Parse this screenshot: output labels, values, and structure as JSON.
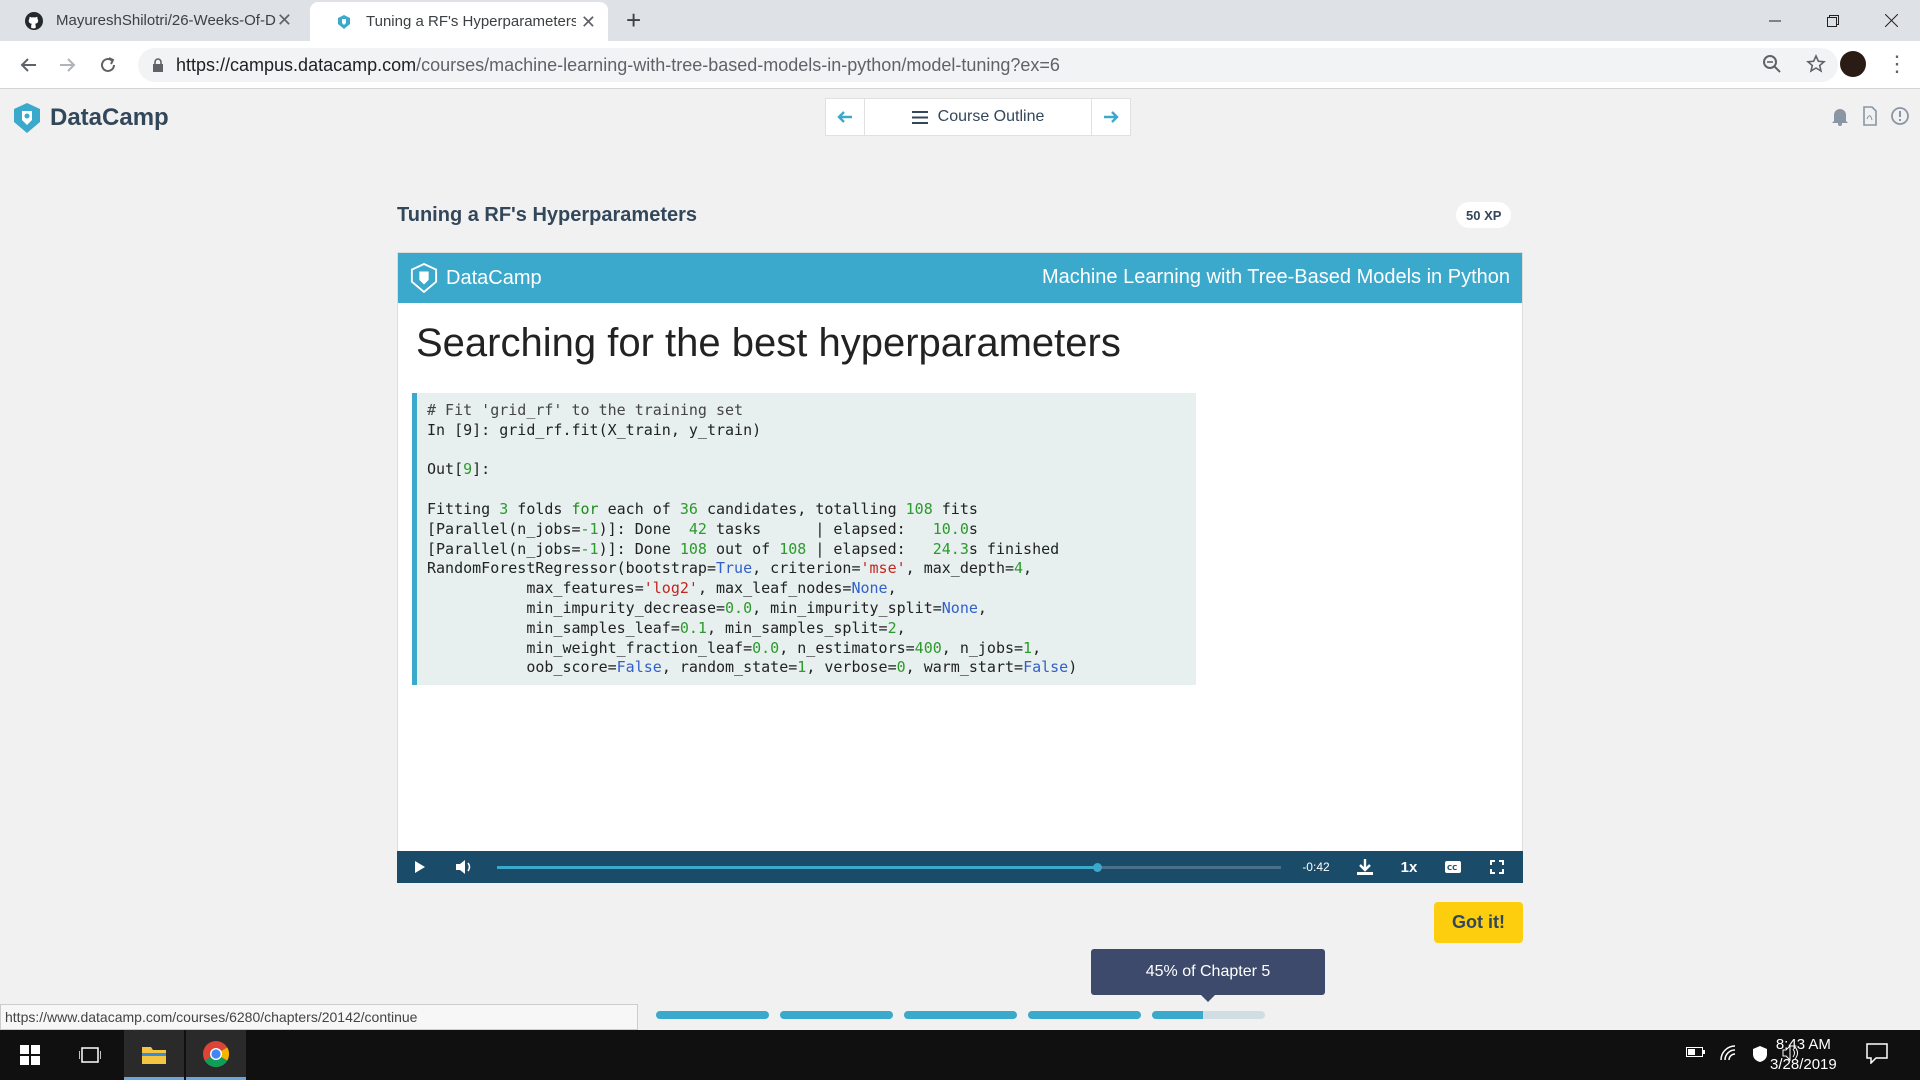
{
  "browser": {
    "tabs": [
      {
        "title": "MayureshShilotri/26-Weeks-Of-D",
        "close": "✕"
      },
      {
        "title": "Tuning a RF's Hyperparameters |",
        "close": "✕"
      }
    ],
    "new_tab": "+",
    "url_host": "https://campus.datacamp.com",
    "url_path": "/courses/machine-learning-with-tree-based-models-in-python/model-tuning?ex=6"
  },
  "header": {
    "brand": "DataCamp",
    "course_outline": "Course Outline"
  },
  "exercise": {
    "title": "Tuning a RF's Hyperparameters",
    "xp": "50 XP"
  },
  "slide": {
    "brand": "DataCamp",
    "course": "Machine Learning with Tree-Based Models in Python",
    "heading": "Searching for the best hyperparameters"
  },
  "code": {
    "l1": "# Fit 'grid_rf' to the training set",
    "l2_prompt": "In [9]: ",
    "l2_code": "grid_rf.fit(X_train, y_train)",
    "out_label": "Out[",
    "out_num": "9",
    "out_end": "]:",
    "fit_a": "Fitting ",
    "fit_n1": "3",
    "fit_b": " folds ",
    "fit_kw": "for",
    "fit_c": " each of ",
    "fit_n2": "36",
    "fit_d": " candidates, totalling ",
    "fit_n3": "108",
    "fit_e": " fits",
    "p1_a": "[Parallel(n_jobs=",
    "p1_n": "-1",
    "p1_b": ")]: Done  ",
    "p1_n2": "42",
    "p1_c": " tasks      | elapsed:   ",
    "p1_n3": "10.0",
    "p1_d": "s",
    "p2_a": "[Parallel(n_jobs=",
    "p2_n": "-1",
    "p2_b": ")]: Done ",
    "p2_n2": "108",
    "p2_c": " out of ",
    "p2_n3": "108",
    "p2_d": " | elapsed:   ",
    "p2_n4": "24.3",
    "p2_e": "s finished",
    "r1_a": "RandomForestRegressor(bootstrap=",
    "r1_t": "True",
    "r1_b": ", criterion=",
    "r1_s": "'mse'",
    "r1_c": ", max_depth=",
    "r1_n": "4",
    "r1_d": ",",
    "r2_a": "           max_features=",
    "r2_s": "'log2'",
    "r2_b": ", max_leaf_nodes=",
    "r2_t": "None",
    "r2_c": ",",
    "r3_a": "           min_impurity_decrease=",
    "r3_n": "0.0",
    "r3_b": ", min_impurity_split=",
    "r3_t": "None",
    "r3_c": ",",
    "r4_a": "           min_samples_leaf=",
    "r4_n": "0.1",
    "r4_b": ", min_samples_split=",
    "r4_n2": "2",
    "r4_c": ",",
    "r5_a": "           min_weight_fraction_leaf=",
    "r5_n": "0.0",
    "r5_b": ", n_estimators=",
    "r5_n2": "400",
    "r5_c": ", n_jobs=",
    "r5_n3": "1",
    "r5_d": ",",
    "r6_a": "           oob_score=",
    "r6_t": "False",
    "r6_b": ", random_state=",
    "r6_n": "1",
    "r6_c": ", verbose=",
    "r6_n2": "0",
    "r6_d": ", warm_start=",
    "r6_t2": "False",
    "r6_e": ")"
  },
  "player": {
    "time_remaining": "-0:42",
    "speed": "1x",
    "progress": 0.765
  },
  "actions": {
    "got_it": "Got it!",
    "chapter_progress": "45% of Chapter 5"
  },
  "progress_segments": [
    1,
    1,
    1,
    1,
    0.45
  ],
  "status_url": "https://www.datacamp.com/courses/6280/chapters/20142/continue",
  "taskbar": {
    "time": "8:43 AM",
    "date": "3/28/2019"
  },
  "colors": {
    "accent": "#3ba9cc",
    "player_bg": "#1a4b69",
    "got_it": "#fcce0d",
    "bubble": "#3d4a6b"
  }
}
